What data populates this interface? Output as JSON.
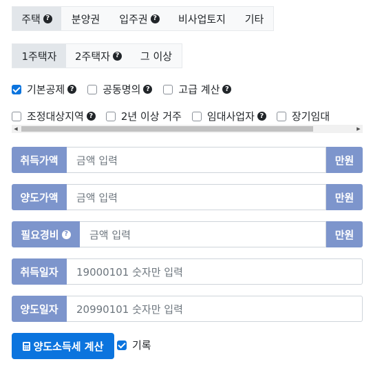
{
  "property_tabs": [
    {
      "label": "주택",
      "help": true,
      "active": true
    },
    {
      "label": "분양권",
      "help": false,
      "active": false
    },
    {
      "label": "입주권",
      "help": true,
      "active": false
    },
    {
      "label": "비사업토지",
      "help": false,
      "active": false
    },
    {
      "label": "기타",
      "help": false,
      "active": false
    }
  ],
  "owner_tabs": [
    {
      "label": "1주택자",
      "help": false,
      "active": true
    },
    {
      "label": "2주택자",
      "help": true,
      "active": false
    },
    {
      "label": "그 이상",
      "help": false,
      "active": false
    }
  ],
  "options_row1": [
    {
      "label": "기본공제",
      "checked": true,
      "help": true
    },
    {
      "label": "공동명의",
      "checked": false,
      "help": true
    },
    {
      "label": "고급 계산",
      "checked": false,
      "help": true
    }
  ],
  "options_row2": [
    {
      "label": "조정대상지역",
      "checked": false,
      "help": true
    },
    {
      "label": "2년 이상 거주",
      "checked": false,
      "help": false
    },
    {
      "label": "임대사업자",
      "checked": false,
      "help": true
    },
    {
      "label": "장기임대",
      "checked": false,
      "help": false
    }
  ],
  "fields": {
    "acquisition_price": {
      "label": "취득가액",
      "placeholder": "금액 입력",
      "unit": "만원"
    },
    "transfer_price": {
      "label": "양도가액",
      "placeholder": "금액 입력",
      "unit": "만원"
    },
    "expenses": {
      "label": "필요경비",
      "placeholder": "금액 입력",
      "unit": "만원"
    },
    "acquisition_date": {
      "label": "취득일자",
      "placeholder": "19000101 숫자만 입력"
    },
    "transfer_date": {
      "label": "양도일자",
      "placeholder": "20990101 숫자만 입력"
    }
  },
  "calculate_button": {
    "label": "양도소득세 계산",
    "icon": "calculator-icon"
  },
  "record": {
    "label": "기록",
    "checked": true
  },
  "colors": {
    "label_bg": "#7d95cc",
    "primary": "#0b74de",
    "tab_bg": "#f8f9fa",
    "tab_active": "#e2e6ea"
  }
}
